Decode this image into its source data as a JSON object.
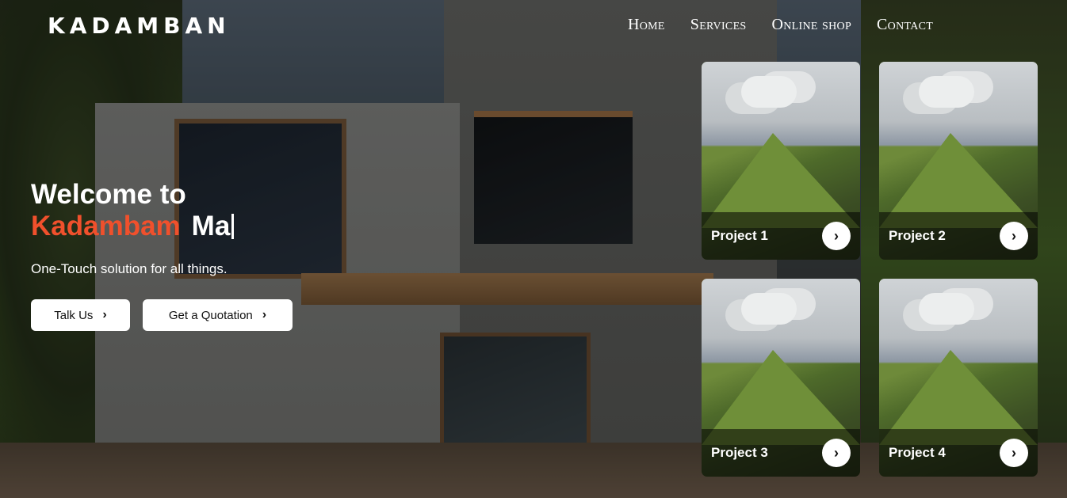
{
  "brand": {
    "logo": "KADAMBAN",
    "accent_color": "#f0502c"
  },
  "nav": {
    "items": [
      "Home",
      "Services",
      "Online shop",
      "Contact"
    ]
  },
  "hero": {
    "welcome": "Welcome to",
    "brand_name": "Kadambam",
    "typed_text": "Ma",
    "tagline": "One-Touch solution for all things."
  },
  "buttons": {
    "talk": "Talk Us",
    "quote": "Get a Quotation",
    "chevron_icon": "chevron-right-icon"
  },
  "projects": [
    {
      "title": "Project 1"
    },
    {
      "title": "Project 2"
    },
    {
      "title": "Project 3"
    },
    {
      "title": "Project 4"
    }
  ]
}
